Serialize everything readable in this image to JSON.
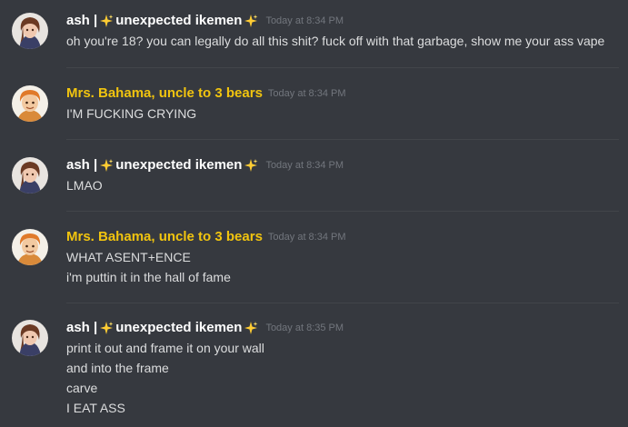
{
  "theme": {
    "background": "#36393f",
    "text": "#dcddde",
    "timestamp": "#72767d",
    "name_default": "#ffffff",
    "name_gold": "#f1c40f",
    "divider": "#42454a"
  },
  "messages": [
    {
      "author": "ash | ",
      "author_suffix": "unexpected ikemen",
      "name_color": "white",
      "avatar": "ash-avatar",
      "timestamp": "Today at 8:34 PM",
      "lines": [
        "oh you're 18? you can legally do all this shit? fuck off with that garbage, show me your ass vape"
      ]
    },
    {
      "author": "Mrs. Bahama, uncle to 3 bears",
      "name_color": "gold",
      "avatar": "bahama-avatar",
      "timestamp": "Today at 8:34 PM",
      "lines": [
        "I'M FUCKING  CRYING"
      ]
    },
    {
      "author": "ash | ",
      "author_suffix": "unexpected ikemen",
      "name_color": "white",
      "avatar": "ash-avatar",
      "timestamp": "Today at 8:34 PM",
      "lines": [
        "LMAO"
      ]
    },
    {
      "author": "Mrs. Bahama, uncle to 3 bears",
      "name_color": "gold",
      "avatar": "bahama-avatar",
      "timestamp": "Today at 8:34 PM",
      "lines": [
        "WHAT  ASENT+ENCE",
        "i'm puttin it in the hall of fame"
      ]
    },
    {
      "author": "ash | ",
      "author_suffix": "unexpected ikemen",
      "name_color": "white",
      "avatar": "ash-avatar",
      "timestamp": "Today at 8:35 PM",
      "lines": [
        "print it out and frame it on your wall",
        "and into the frame",
        "carve",
        "I EAT ASS"
      ]
    }
  ]
}
